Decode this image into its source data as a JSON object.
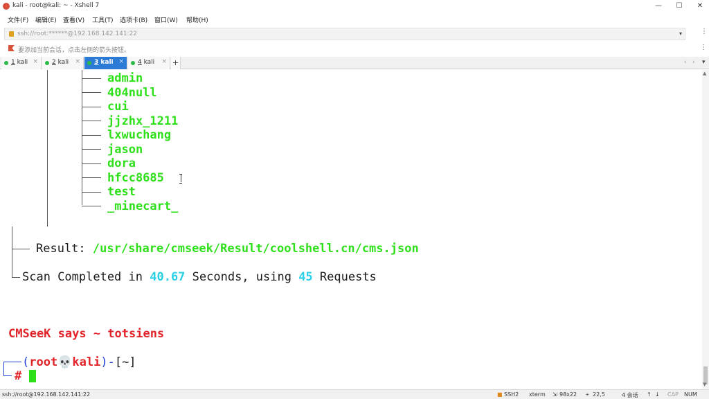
{
  "window": {
    "title": "kali - root@kali: ~ - Xshell 7",
    "minimize": "—",
    "maximize": "☐",
    "close": "✕"
  },
  "menu": [
    "文件(F)",
    "编辑(E)",
    "查看(V)",
    "工具(T)",
    "选项卡(B)",
    "窗口(W)",
    "帮助(H)"
  ],
  "address": {
    "value": "ssh://root:******@192.168.142.141:22",
    "dropdown": "▾"
  },
  "hint": {
    "text": "要添加当前会话，点击左侧的箭头按钮。"
  },
  "tabs": [
    {
      "num": "1",
      "label": "kali",
      "active": false
    },
    {
      "num": "2",
      "label": "kali",
      "active": false
    },
    {
      "num": "3",
      "label": "kali",
      "active": true
    },
    {
      "num": "4",
      "label": "kali",
      "active": false
    }
  ],
  "tab_add": "+",
  "terminal": {
    "users": [
      "admin",
      "404null",
      "cui",
      "jjzhx_1211",
      "lxwuchang",
      "jason",
      "dora",
      "hfcc8685",
      "test",
      "_minecart_"
    ],
    "result_label": "Result: ",
    "result_path": "/usr/share/cmseek/Result/coolshell.cn/cms.json",
    "scan_prefix": "Scan Completed in ",
    "scan_seconds": "40.67",
    "scan_mid": " Seconds, using ",
    "scan_requests": "45",
    "scan_suffix": " Requests",
    "says": "CMSeeK says ~ totsiens",
    "prompt_open": "(",
    "prompt_user": "root",
    "prompt_skull": "💀",
    "prompt_host": "kali",
    "prompt_close": ")",
    "prompt_dash": "-",
    "prompt_dir": "[~]",
    "prompt_hash": "#"
  },
  "status": {
    "connection": "ssh://root@192.168.142.141:22",
    "protocol": "SSH2",
    "term": "xterm",
    "size": "98x22",
    "pos": "22,5",
    "sessions": "4 会话",
    "cap": "CAP",
    "num": "NUM"
  },
  "colors": {
    "green": "#2ee01a",
    "cyan": "#2ad0e6",
    "red": "#e0242a",
    "blue": "#2040d8",
    "tab_active": "#2b7bd6"
  }
}
